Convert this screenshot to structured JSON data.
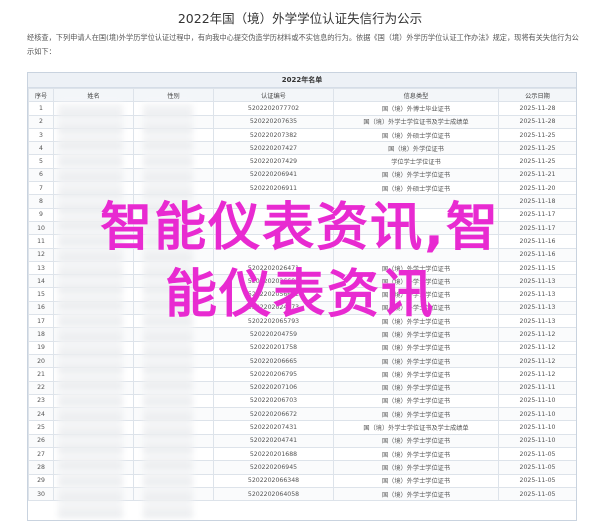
{
  "page": {
    "title": "2022年国（境）外学学位认证失信行为公示",
    "intro": "经核查，下列申请人在国(境)外学历学位认证过程中，有向我中心提交伪造学历材料或不实信息的行为。依据《国（境）外学历学位认证工作办法》规定，现将有关失信行为公示如下："
  },
  "table": {
    "title": "2022年名单",
    "headers": [
      "序号",
      "姓名",
      "性别",
      "认证编号",
      "信息类型",
      "公示日期"
    ],
    "rows": [
      [
        "1",
        "",
        "",
        "5202202077702",
        "国（境）外博士毕业证书",
        "2025-11-28"
      ],
      [
        "2",
        "",
        "",
        "520220207635",
        "国（境）外学士学位证书及学士成绩单",
        "2025-11-28"
      ],
      [
        "3",
        "",
        "",
        "520220207382",
        "国（境）外硕士学位证书",
        "2025-11-25"
      ],
      [
        "4",
        "",
        "",
        "520220207427",
        "国（境）外学位证书",
        "2025-11-25"
      ],
      [
        "5",
        "",
        "",
        "520220207429",
        "学位学士学位证书",
        "2025-11-25"
      ],
      [
        "6",
        "",
        "",
        "520220206941",
        "国（境）外学士学位证书",
        "2025-11-21"
      ],
      [
        "7",
        "",
        "",
        "520220206911",
        "国（境）外硕士学位证书",
        "2025-11-20"
      ],
      [
        "8",
        "",
        "",
        "",
        "",
        "2025-11-18"
      ],
      [
        "9",
        "",
        "",
        "",
        "",
        "2025-11-17"
      ],
      [
        "10",
        "",
        "",
        "",
        "",
        "2025-11-17"
      ],
      [
        "11",
        "",
        "",
        "",
        "",
        "2025-11-16"
      ],
      [
        "12",
        "",
        "",
        "",
        "",
        "2025-11-16"
      ],
      [
        "13",
        "",
        "",
        "5202202026471",
        "国（境）外学士学位证书",
        "2025-11-15"
      ],
      [
        "14",
        "",
        "",
        "5202202026695",
        "国（境）外学士学位证书",
        "2025-11-13"
      ],
      [
        "15",
        "",
        "",
        "5202202056652",
        "国（境）外学士学位证书",
        "2025-11-13"
      ],
      [
        "16",
        "",
        "",
        "5202202024773",
        "国（境）外学士学位证书",
        "2025-11-13"
      ],
      [
        "17",
        "",
        "",
        "5202202065793",
        "国（境）外学士学位证书",
        "2025-11-13"
      ],
      [
        "18",
        "",
        "",
        "520220204759",
        "国（境）外学士学位证书",
        "2025-11-12"
      ],
      [
        "19",
        "",
        "",
        "520220201758",
        "国（境）外学士学位证书",
        "2025-11-12"
      ],
      [
        "20",
        "",
        "",
        "520220206665",
        "国（境）外学士学位证书",
        "2025-11-12"
      ],
      [
        "21",
        "",
        "",
        "520220206795",
        "国（境）外学士学位证书",
        "2025-11-12"
      ],
      [
        "22",
        "",
        "",
        "520220207106",
        "国（境）外学士学位证书",
        "2025-11-11"
      ],
      [
        "23",
        "",
        "",
        "520220206703",
        "国（境）外学士学位证书",
        "2025-11-10"
      ],
      [
        "24",
        "",
        "",
        "520220206672",
        "国（境）外学士学位证书",
        "2025-11-10"
      ],
      [
        "25",
        "",
        "",
        "520220207431",
        "国（境）外学士学位证书及学士成绩单",
        "2025-11-10"
      ],
      [
        "26",
        "",
        "",
        "520220204741",
        "国（境）外学士学位证书",
        "2025-11-10"
      ],
      [
        "27",
        "",
        "",
        "520220201688",
        "国（境）外学士学位证书",
        "2025-11-05"
      ],
      [
        "28",
        "",
        "",
        "520220206945",
        "国（境）外学士学位证书",
        "2025-11-05"
      ],
      [
        "29",
        "",
        "",
        "5202202066348",
        "国（境）外学士学位证书",
        "2025-11-05"
      ],
      [
        "30",
        "",
        "",
        "5202202064058",
        "国（境）外学士学位证书",
        "2025-11-05"
      ]
    ]
  },
  "watermark": {
    "line1": "智能仪表资讯,智",
    "line2": "能仪表资讯",
    "color": "#e82ad1"
  }
}
